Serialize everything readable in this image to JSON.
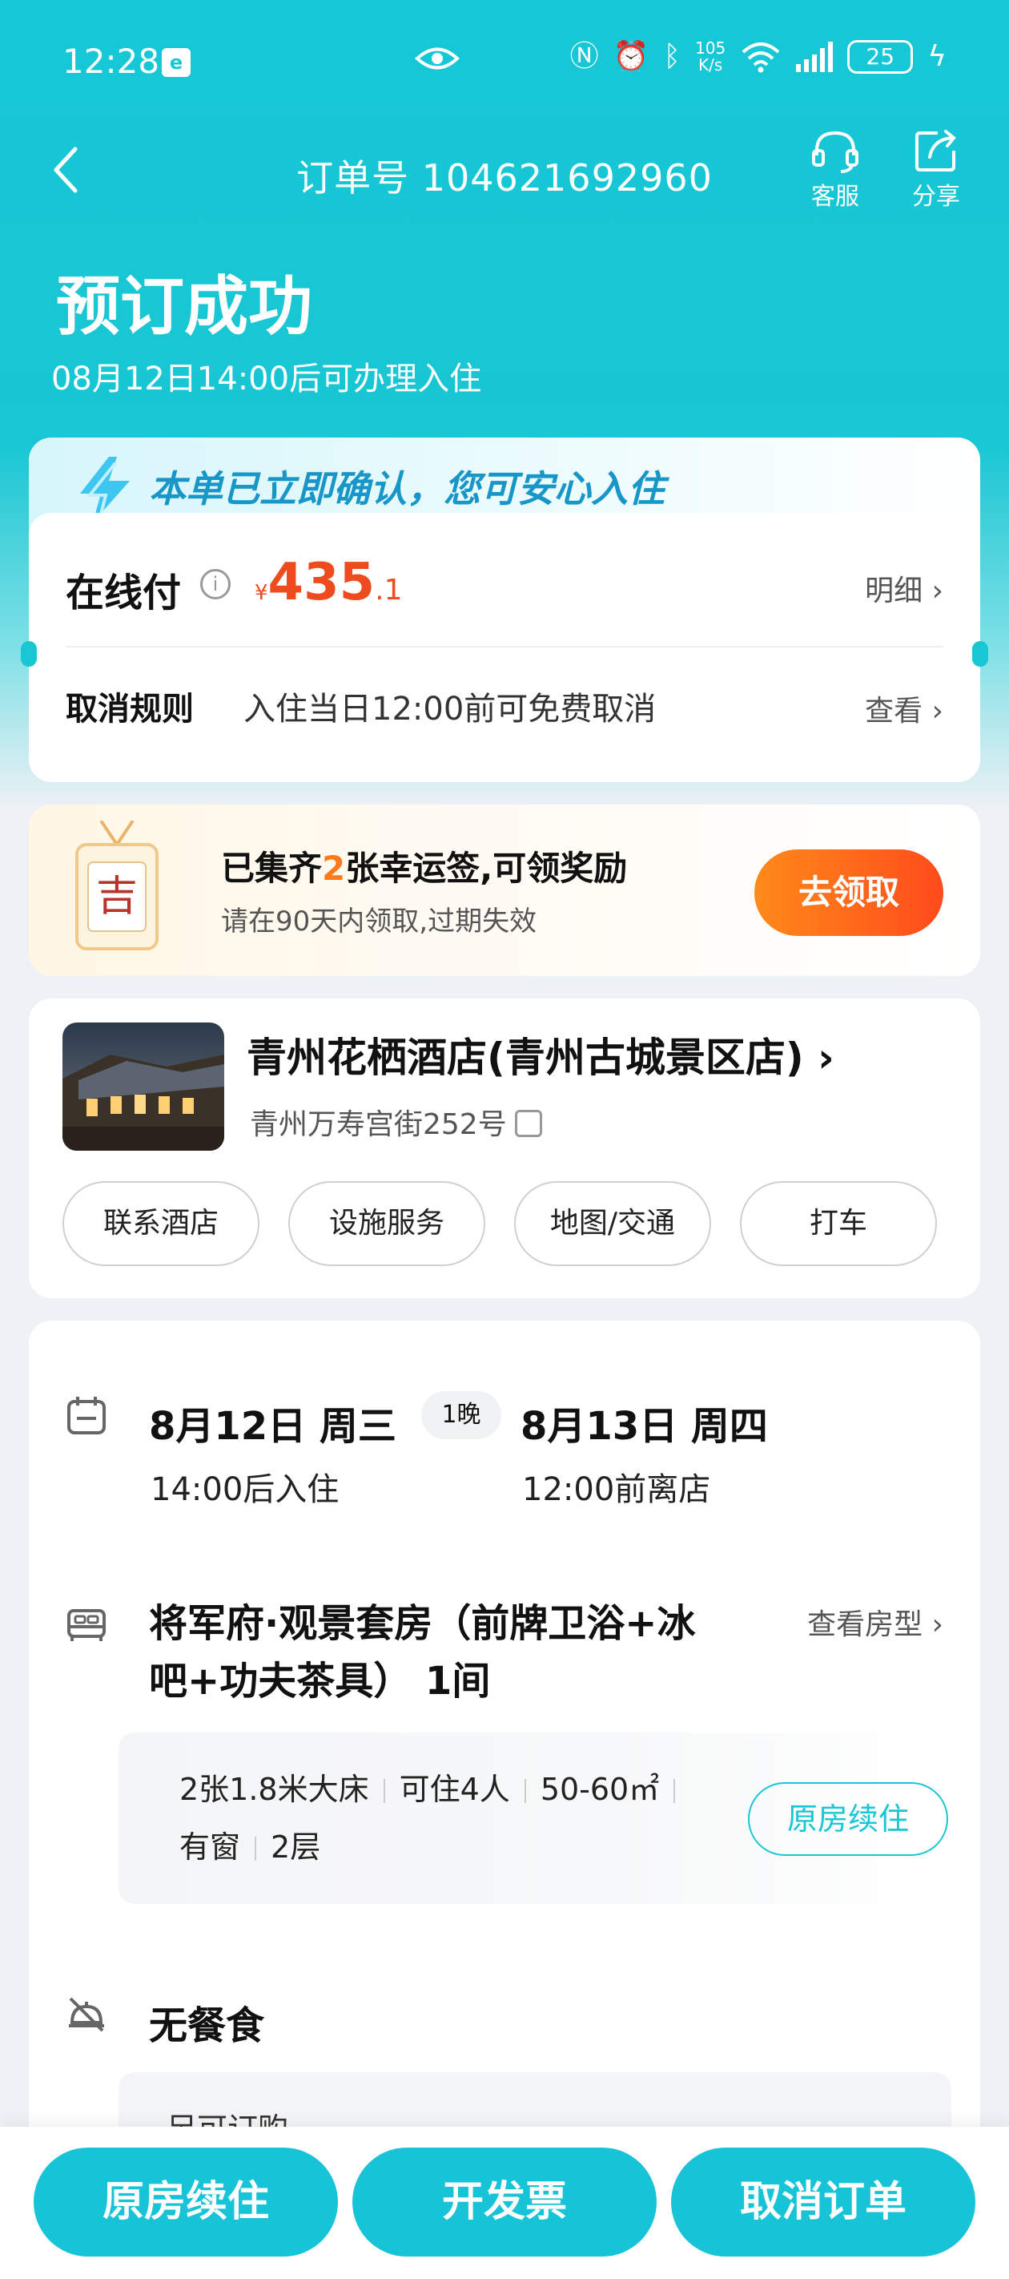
{
  "status_bar": {
    "time": "12:28",
    "speed_value": "105",
    "speed_unit": "K/s",
    "battery": "25",
    "icons": [
      "sim-icon",
      "eye-icon",
      "nfc-icon",
      "alarm-icon",
      "bluetooth-icon",
      "wifi-icon",
      "signal-icon",
      "charging-icon"
    ]
  },
  "header": {
    "order_label": "订单号 104621692960",
    "service_label": "客服",
    "share_label": "分享",
    "status_title": "预订成功",
    "checkin_note": "08月12日14:00后可办理入住"
  },
  "confirm_banner": {
    "text": "本单已立即确认，您可安心入住"
  },
  "payment": {
    "label": "在线付",
    "currency": "¥",
    "amount_int": "435",
    "amount_dec": ".1",
    "detail_link": "明细",
    "cancel_label": "取消规则",
    "cancel_value": "入住当日12:00前可免费取消",
    "cancel_link": "查看"
  },
  "lucky": {
    "tag_char": "吉",
    "title_prefix": "已集齐",
    "title_count": "2",
    "title_suffix": "张幸运签,可领奖励",
    "subtitle": "请在90天内领取,过期失效",
    "button": "去领取"
  },
  "hotel": {
    "name": "青州花栖酒店(青州古城景区店)",
    "address": "青州万寿宫街252号",
    "actions": [
      "联系酒店",
      "设施服务",
      "地图/交通",
      "打车"
    ]
  },
  "stay": {
    "checkin_date": "8月12日 周三",
    "checkin_time": "14:00后入住",
    "nights": "1晚",
    "checkout_date": "8月13日 周四",
    "checkout_time": "12:00前离店"
  },
  "room": {
    "name": "将军府·观景套房（前牌卫浴+冰吧+功夫茶具） 1间",
    "view_link": "查看房型",
    "specs_line1": [
      "2张1.8米大床",
      "可住4人",
      "50-60㎡"
    ],
    "specs_line2": [
      "有窗",
      "2层"
    ],
    "renew_label": "原房续住"
  },
  "meal": {
    "label": "无餐食",
    "note": "另可订购"
  },
  "bottom_bar": {
    "renew": "原房续住",
    "invoice": "开发票",
    "cancel": "取消订单"
  },
  "colors": {
    "brand": "#19c6d3",
    "price": "#ee4b1f",
    "claim": "#ff5a1c"
  }
}
